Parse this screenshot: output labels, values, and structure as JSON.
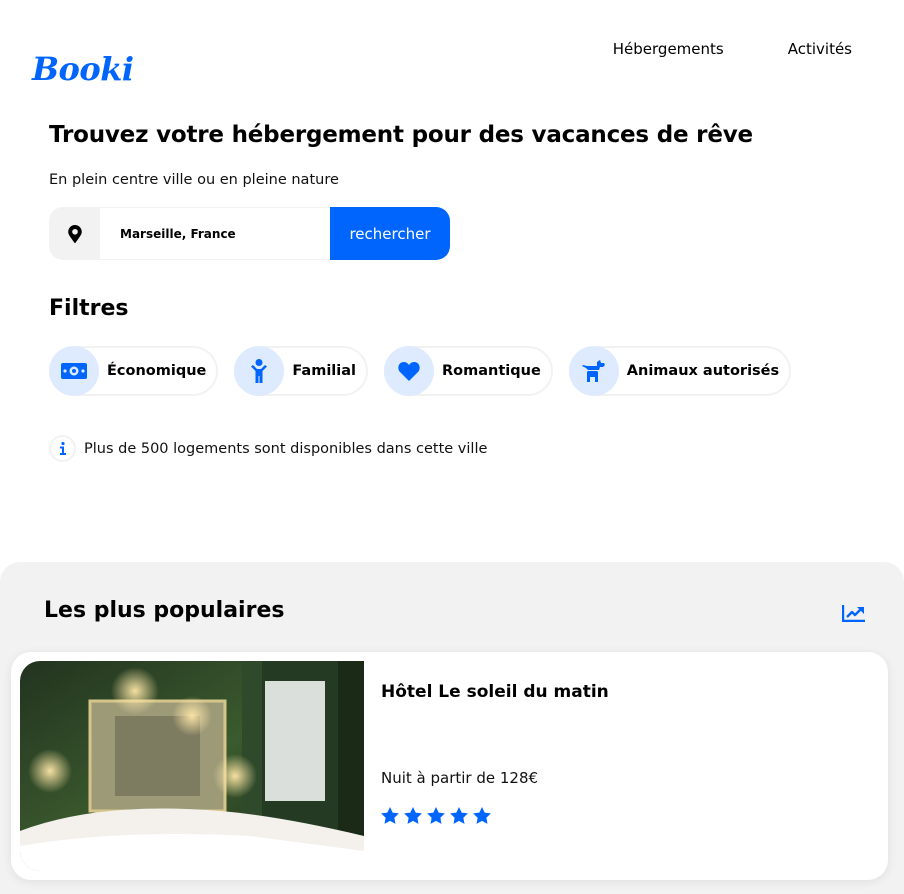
{
  "header": {
    "logo": "Booki",
    "nav": [
      "Hébergements",
      "Activités"
    ]
  },
  "hero": {
    "title": "Trouvez votre hébergement pour des vacances de rêve",
    "subtitle": "En plein centre ville ou en pleine nature"
  },
  "search": {
    "value": "Marseille, France",
    "button_label": "rechercher",
    "pin_icon": "map-pin-icon"
  },
  "filters": {
    "title": "Filtres",
    "items": [
      {
        "label": "Économique",
        "icon": "money-bill-icon"
      },
      {
        "label": "Familial",
        "icon": "child-icon"
      },
      {
        "label": "Romantique",
        "icon": "heart-icon"
      },
      {
        "label": "Animaux autorisés",
        "icon": "dog-icon"
      }
    ]
  },
  "info": {
    "text": "Plus de 500 logements sont disponibles dans cette ville",
    "icon": "info-icon"
  },
  "popular": {
    "title": "Les plus populaires",
    "icon": "trending-up-icon",
    "card": {
      "title": "Hôtel Le soleil du matin",
      "price": "Nuit à partir de 128€",
      "rating": 5
    }
  },
  "colors": {
    "primary": "#0065FC",
    "icon_bg": "#DEEBFF",
    "light_gray": "#F2F2F2"
  }
}
